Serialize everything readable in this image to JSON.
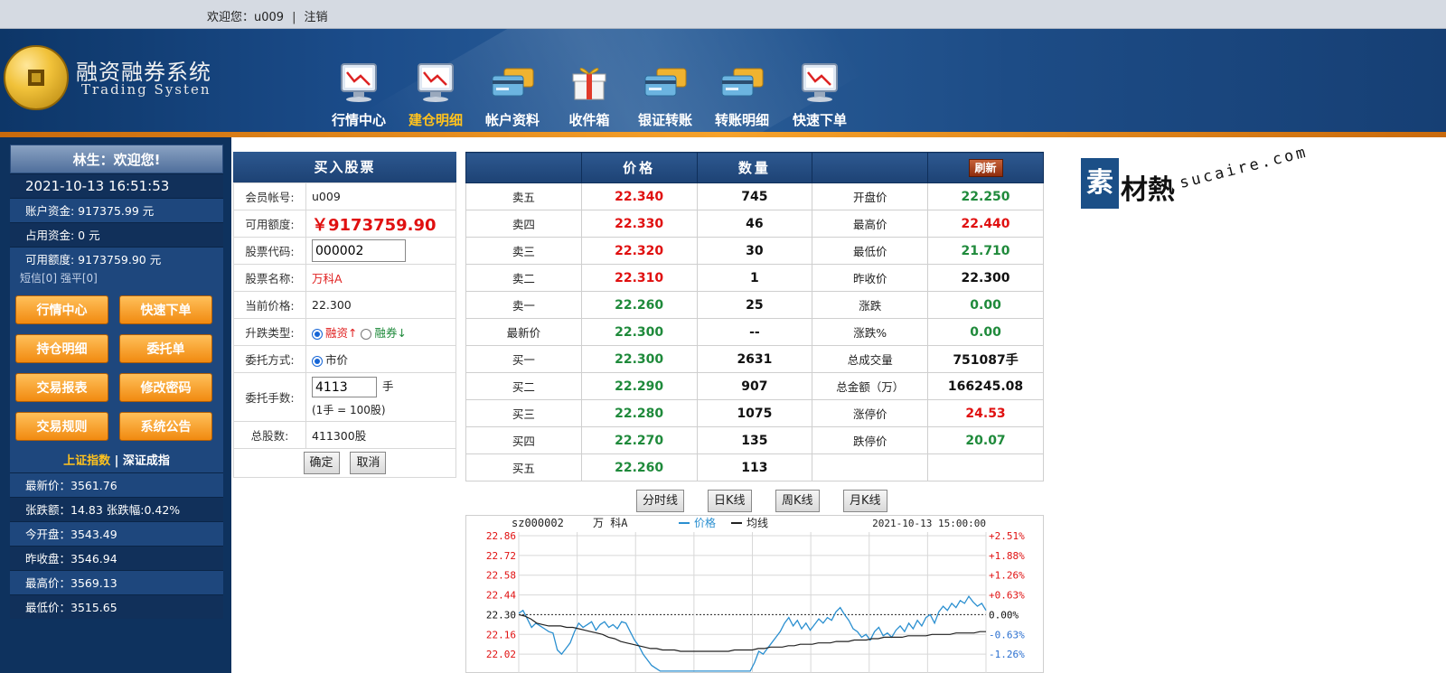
{
  "topbar": {
    "welcome_text": "欢迎您：u009",
    "separator": "|",
    "logout": "注销"
  },
  "brand": {
    "name_cn": "融资融券系统",
    "name_en": "Trading Systen"
  },
  "nav": [
    {
      "label": "行情中心",
      "icon": "monitor-chart-icon",
      "active": false
    },
    {
      "label": "建仓明细",
      "icon": "monitor-chart-icon",
      "active": true
    },
    {
      "label": "帐户资料",
      "icon": "cards-icon",
      "active": false
    },
    {
      "label": "收件箱",
      "icon": "gift-box-icon",
      "active": false
    },
    {
      "label": "银证转账",
      "icon": "cards-icon",
      "active": false
    },
    {
      "label": "转账明细",
      "icon": "cards-icon",
      "active": false
    },
    {
      "label": "快速下单",
      "icon": "monitor-chart-icon",
      "active": false
    }
  ],
  "sidebar": {
    "greeting": "林生：欢迎您!",
    "datetime": "2021-10-13 16:51:53",
    "account_funds": "账户资金:   917375.99 元",
    "occupied_funds": "占用资金:   0  元",
    "available_amount": "可用额度:   9173759.90 元",
    "messages": "短信[0] 强平[0]",
    "buttons": [
      "行情中心",
      "快速下单",
      "持仓明细",
      "委托单",
      "交易报表",
      "修改密码",
      "交易规则",
      "系统公告"
    ],
    "index_tab_sh": "上证指数",
    "index_sep": "|",
    "index_tab_sz": "深证成指",
    "index_rows": [
      "最新价：3561.76",
      "张跌额：14.83 张跌幅:0.42%",
      "今开盘：3543.49",
      "昨收盘：3546.94",
      "最高价：3569.13",
      "最低价：3515.65"
    ]
  },
  "buy_form": {
    "title": "买入股票",
    "member_label": "会员帐号:",
    "member_value": "u009",
    "available_label": "可用额度:",
    "available_value": "￥9173759.90",
    "code_label": "股票代码:",
    "code_value": "000002",
    "name_label": "股票名称:",
    "name_value": "万科A",
    "price_label": "当前价格:",
    "price_value": "22.300",
    "type_label": "升跌类型:",
    "type_opt1": "融资↑",
    "type_opt2": "融券↓",
    "method_label": "委托方式:",
    "method_opt": "市价",
    "lots_label": "委托手数:",
    "lots_value": "4113",
    "lots_unit": "手",
    "lots_note": "(1手 = 100股)",
    "total_label": "总股数:",
    "total_value": "411300股",
    "confirm": "确定",
    "cancel": "取消"
  },
  "quote": {
    "col_price": "价格",
    "col_qty": "数量",
    "refresh": "刷新",
    "rows": [
      {
        "name": "卖五",
        "price": "22.340",
        "pc": "red",
        "qty": "745",
        "k": "开盘价",
        "v": "22.250",
        "vc": "green"
      },
      {
        "name": "卖四",
        "price": "22.330",
        "pc": "red",
        "qty": "46",
        "k": "最高价",
        "v": "22.440",
        "vc": "red"
      },
      {
        "name": "卖三",
        "price": "22.320",
        "pc": "red",
        "qty": "30",
        "k": "最低价",
        "v": "21.710",
        "vc": "green"
      },
      {
        "name": "卖二",
        "price": "22.310",
        "pc": "red",
        "qty": "1",
        "k": "昨收价",
        "v": "22.300",
        "vc": "black"
      },
      {
        "name": "卖一",
        "price": "22.260",
        "pc": "green",
        "qty": "25",
        "k": "涨跌",
        "v": "0.00",
        "vc": "green"
      },
      {
        "name": "最新价",
        "price": "22.300",
        "pc": "green",
        "qty": "--",
        "k": "涨跌%",
        "v": "0.00",
        "vc": "green"
      },
      {
        "name": "买一",
        "price": "22.300",
        "pc": "green",
        "qty": "2631",
        "k": "总成交量",
        "v": "751087手",
        "vc": "black"
      },
      {
        "name": "买二",
        "price": "22.290",
        "pc": "green",
        "qty": "907",
        "k": "总金额（万）",
        "v": "166245.08",
        "vc": "black"
      },
      {
        "name": "买三",
        "price": "22.280",
        "pc": "green",
        "qty": "1075",
        "k": "涨停价",
        "v": "24.53",
        "vc": "red"
      },
      {
        "name": "买四",
        "price": "22.270",
        "pc": "green",
        "qty": "135",
        "k": "跌停价",
        "v": "20.07",
        "vc": "green"
      },
      {
        "name": "买五",
        "price": "22.260",
        "pc": "green",
        "qty": "113",
        "k": "",
        "v": "",
        "vc": "black"
      }
    ]
  },
  "chart_tabs": [
    "分时线",
    "日K线",
    "周K线",
    "月K线"
  ],
  "chart_data": {
    "type": "line",
    "code": "sz000002",
    "stock_name": "万 科A",
    "legend_price": "价格",
    "legend_avg": "均线",
    "timestamp": "2021-10-13  15:00:00",
    "left_ticks": [
      "22.86",
      "22.72",
      "22.58",
      "22.44",
      "22.30",
      "22.16",
      "22.02"
    ],
    "left_tick_colors": [
      "red",
      "red",
      "red",
      "red",
      "black",
      "red",
      "red"
    ],
    "right_ticks": [
      "+2.51%",
      "+1.88%",
      "+1.26%",
      "+0.63%",
      "0.00%",
      "-0.63%",
      "-1.26%"
    ],
    "right_tick_colors": [
      "red",
      "red",
      "red",
      "red",
      "black",
      "blue",
      "blue"
    ],
    "ylim": [
      21.88,
      22.86
    ],
    "reference": 22.3,
    "series": [
      {
        "name": "价格",
        "color": "#2a8fd0",
        "values": [
          22.31,
          22.33,
          22.27,
          22.21,
          22.24,
          22.22,
          22.2,
          22.18,
          22.17,
          22.05,
          22.02,
          22.06,
          22.1,
          22.18,
          22.24,
          22.21,
          22.23,
          22.25,
          22.19,
          22.23,
          22.25,
          22.21,
          22.23,
          22.2,
          22.25,
          22.24,
          22.18,
          22.12,
          22.08,
          22.02,
          21.98,
          21.94,
          21.92,
          21.9,
          21.9,
          21.9,
          21.9,
          21.9,
          21.9,
          21.9,
          21.9,
          21.9,
          21.9,
          21.9,
          21.9,
          21.9,
          21.9,
          21.9,
          21.9,
          21.9,
          21.9,
          21.9,
          21.9,
          21.9,
          21.9,
          21.96,
          22.04,
          22.02,
          22.06,
          22.1,
          22.14,
          22.18,
          22.24,
          22.28,
          22.22,
          22.26,
          22.2,
          22.24,
          22.19,
          22.23,
          22.27,
          22.24,
          22.28,
          22.26,
          22.32,
          22.35,
          22.3,
          22.26,
          22.2,
          22.18,
          22.14,
          22.16,
          22.12,
          22.18,
          22.21,
          22.15,
          22.17,
          22.14,
          22.19,
          22.22,
          22.18,
          22.24,
          22.2,
          22.26,
          22.22,
          22.28,
          22.3,
          22.24,
          22.32,
          22.36,
          22.33,
          22.38,
          22.35,
          22.4,
          22.38,
          22.43,
          22.39,
          22.36,
          22.38,
          22.33
        ]
      },
      {
        "name": "均线",
        "color": "#222222",
        "values": [
          22.3,
          22.29,
          22.27,
          22.24,
          22.23,
          22.22,
          22.22,
          22.22,
          22.21,
          22.21,
          22.2,
          22.19,
          22.18,
          22.17,
          22.16,
          22.14,
          22.13,
          22.11,
          22.1,
          22.09,
          22.08,
          22.07,
          22.06,
          22.06,
          22.05,
          22.05,
          22.05,
          22.04,
          22.04,
          22.04,
          22.04,
          22.04,
          22.04,
          22.04,
          22.04,
          22.04,
          22.05,
          22.05,
          22.05,
          22.05,
          22.06,
          22.06,
          22.07,
          22.07,
          22.07,
          22.08,
          22.08,
          22.09,
          22.09,
          22.09,
          22.1,
          22.1,
          22.1,
          22.11,
          22.11,
          22.11,
          22.12,
          22.12,
          22.12,
          22.13,
          22.13,
          22.14,
          22.14,
          22.14,
          22.14,
          22.15,
          22.15,
          22.15,
          22.15,
          22.16,
          22.16,
          22.16,
          22.16,
          22.17,
          22.17,
          22.17,
          22.17,
          22.18,
          22.18
        ]
      }
    ]
  },
  "watermark": {
    "cn_block": "素",
    "cn_rest": "材熱",
    "en": "sucaire.com"
  }
}
